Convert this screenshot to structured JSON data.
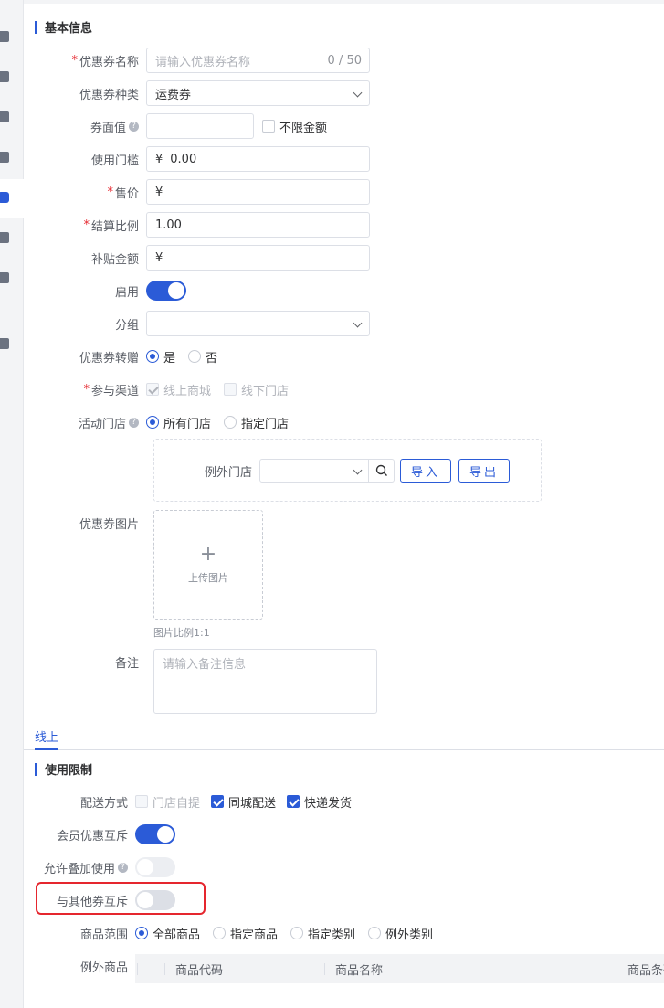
{
  "sections": {
    "basic": "基本信息",
    "limits": "使用限制"
  },
  "fields": {
    "coupon_name": {
      "label": "优惠券名称",
      "placeholder": "请输入优惠券名称",
      "count": "0 / 50"
    },
    "coupon_type": {
      "label": "优惠券种类",
      "value": "运费券"
    },
    "face_value": {
      "label": "券面值",
      "unlimited": "不限金额"
    },
    "threshold": {
      "label": "使用门槛",
      "prefix": "¥",
      "value": "0.00"
    },
    "price": {
      "label": "售价",
      "prefix": "¥"
    },
    "settle_ratio": {
      "label": "结算比例",
      "value": "1.00"
    },
    "subsidy": {
      "label": "补贴金额",
      "prefix": "¥"
    },
    "enabled": {
      "label": "启用"
    },
    "group": {
      "label": "分组"
    },
    "transfer": {
      "label": "优惠券转赠",
      "yes": "是",
      "no": "否"
    },
    "channels": {
      "label": "参与渠道",
      "online": "线上商城",
      "offline": "线下门店"
    },
    "stores": {
      "label": "活动门店",
      "all": "所有门店",
      "specified": "指定门店"
    },
    "exception_store": {
      "label": "例外门店",
      "import_btn": "导入",
      "export_btn": "导出"
    },
    "image": {
      "label": "优惠券图片",
      "upload": "上传图片",
      "hint": "图片比例1:1"
    },
    "remark": {
      "label": "备注",
      "placeholder": "请输入备注信息"
    }
  },
  "tabs": {
    "online": "线上"
  },
  "limits": {
    "delivery": {
      "label": "配送方式",
      "pickup": "门店自提",
      "city": "同城配送",
      "express": "快递发货"
    },
    "member_exclusive": {
      "label": "会员优惠互斥"
    },
    "stackable": {
      "label": "允许叠加使用"
    },
    "coupon_exclusive": {
      "label": "与其他券互斥"
    },
    "scope": {
      "label": "商品范围",
      "all": "全部商品",
      "specified": "指定商品",
      "category": "指定类别",
      "exception_category": "例外类别"
    },
    "exception_goods": {
      "label": "例外商品",
      "columns": [
        "商品代码",
        "商品名称",
        "商品条码"
      ]
    }
  },
  "colors": {
    "primary": "#2b5bd7",
    "required": "#e5262e",
    "highlight": "#e5262e"
  }
}
